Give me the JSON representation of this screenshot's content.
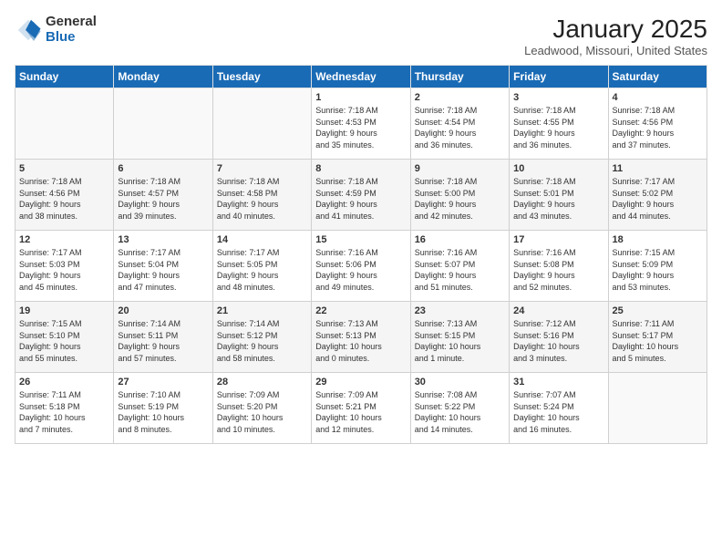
{
  "logo": {
    "general": "General",
    "blue": "Blue"
  },
  "header": {
    "title": "January 2025",
    "location": "Leadwood, Missouri, United States"
  },
  "days_of_week": [
    "Sunday",
    "Monday",
    "Tuesday",
    "Wednesday",
    "Thursday",
    "Friday",
    "Saturday"
  ],
  "weeks": [
    [
      {
        "day": "",
        "info": ""
      },
      {
        "day": "",
        "info": ""
      },
      {
        "day": "",
        "info": ""
      },
      {
        "day": "1",
        "info": "Sunrise: 7:18 AM\nSunset: 4:53 PM\nDaylight: 9 hours\nand 35 minutes."
      },
      {
        "day": "2",
        "info": "Sunrise: 7:18 AM\nSunset: 4:54 PM\nDaylight: 9 hours\nand 36 minutes."
      },
      {
        "day": "3",
        "info": "Sunrise: 7:18 AM\nSunset: 4:55 PM\nDaylight: 9 hours\nand 36 minutes."
      },
      {
        "day": "4",
        "info": "Sunrise: 7:18 AM\nSunset: 4:56 PM\nDaylight: 9 hours\nand 37 minutes."
      }
    ],
    [
      {
        "day": "5",
        "info": "Sunrise: 7:18 AM\nSunset: 4:56 PM\nDaylight: 9 hours\nand 38 minutes."
      },
      {
        "day": "6",
        "info": "Sunrise: 7:18 AM\nSunset: 4:57 PM\nDaylight: 9 hours\nand 39 minutes."
      },
      {
        "day": "7",
        "info": "Sunrise: 7:18 AM\nSunset: 4:58 PM\nDaylight: 9 hours\nand 40 minutes."
      },
      {
        "day": "8",
        "info": "Sunrise: 7:18 AM\nSunset: 4:59 PM\nDaylight: 9 hours\nand 41 minutes."
      },
      {
        "day": "9",
        "info": "Sunrise: 7:18 AM\nSunset: 5:00 PM\nDaylight: 9 hours\nand 42 minutes."
      },
      {
        "day": "10",
        "info": "Sunrise: 7:18 AM\nSunset: 5:01 PM\nDaylight: 9 hours\nand 43 minutes."
      },
      {
        "day": "11",
        "info": "Sunrise: 7:17 AM\nSunset: 5:02 PM\nDaylight: 9 hours\nand 44 minutes."
      }
    ],
    [
      {
        "day": "12",
        "info": "Sunrise: 7:17 AM\nSunset: 5:03 PM\nDaylight: 9 hours\nand 45 minutes."
      },
      {
        "day": "13",
        "info": "Sunrise: 7:17 AM\nSunset: 5:04 PM\nDaylight: 9 hours\nand 47 minutes."
      },
      {
        "day": "14",
        "info": "Sunrise: 7:17 AM\nSunset: 5:05 PM\nDaylight: 9 hours\nand 48 minutes."
      },
      {
        "day": "15",
        "info": "Sunrise: 7:16 AM\nSunset: 5:06 PM\nDaylight: 9 hours\nand 49 minutes."
      },
      {
        "day": "16",
        "info": "Sunrise: 7:16 AM\nSunset: 5:07 PM\nDaylight: 9 hours\nand 51 minutes."
      },
      {
        "day": "17",
        "info": "Sunrise: 7:16 AM\nSunset: 5:08 PM\nDaylight: 9 hours\nand 52 minutes."
      },
      {
        "day": "18",
        "info": "Sunrise: 7:15 AM\nSunset: 5:09 PM\nDaylight: 9 hours\nand 53 minutes."
      }
    ],
    [
      {
        "day": "19",
        "info": "Sunrise: 7:15 AM\nSunset: 5:10 PM\nDaylight: 9 hours\nand 55 minutes."
      },
      {
        "day": "20",
        "info": "Sunrise: 7:14 AM\nSunset: 5:11 PM\nDaylight: 9 hours\nand 57 minutes."
      },
      {
        "day": "21",
        "info": "Sunrise: 7:14 AM\nSunset: 5:12 PM\nDaylight: 9 hours\nand 58 minutes."
      },
      {
        "day": "22",
        "info": "Sunrise: 7:13 AM\nSunset: 5:13 PM\nDaylight: 10 hours\nand 0 minutes."
      },
      {
        "day": "23",
        "info": "Sunrise: 7:13 AM\nSunset: 5:15 PM\nDaylight: 10 hours\nand 1 minute."
      },
      {
        "day": "24",
        "info": "Sunrise: 7:12 AM\nSunset: 5:16 PM\nDaylight: 10 hours\nand 3 minutes."
      },
      {
        "day": "25",
        "info": "Sunrise: 7:11 AM\nSunset: 5:17 PM\nDaylight: 10 hours\nand 5 minutes."
      }
    ],
    [
      {
        "day": "26",
        "info": "Sunrise: 7:11 AM\nSunset: 5:18 PM\nDaylight: 10 hours\nand 7 minutes."
      },
      {
        "day": "27",
        "info": "Sunrise: 7:10 AM\nSunset: 5:19 PM\nDaylight: 10 hours\nand 8 minutes."
      },
      {
        "day": "28",
        "info": "Sunrise: 7:09 AM\nSunset: 5:20 PM\nDaylight: 10 hours\nand 10 minutes."
      },
      {
        "day": "29",
        "info": "Sunrise: 7:09 AM\nSunset: 5:21 PM\nDaylight: 10 hours\nand 12 minutes."
      },
      {
        "day": "30",
        "info": "Sunrise: 7:08 AM\nSunset: 5:22 PM\nDaylight: 10 hours\nand 14 minutes."
      },
      {
        "day": "31",
        "info": "Sunrise: 7:07 AM\nSunset: 5:24 PM\nDaylight: 10 hours\nand 16 minutes."
      },
      {
        "day": "",
        "info": ""
      }
    ]
  ]
}
